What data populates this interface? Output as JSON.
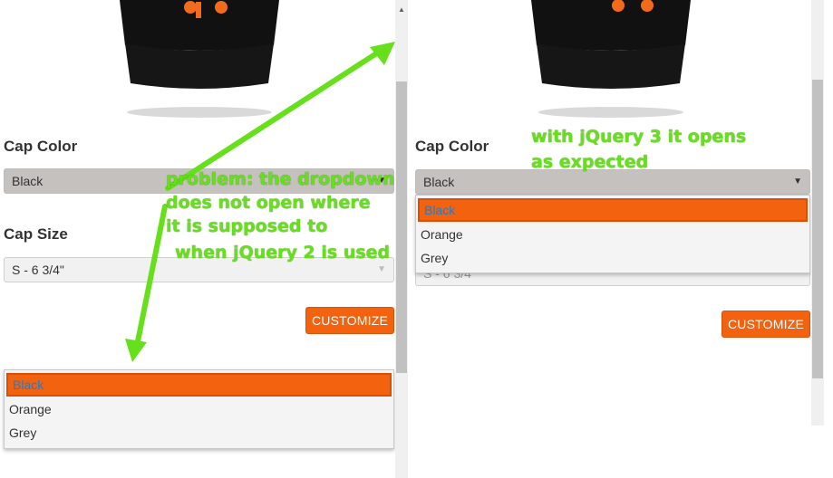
{
  "left": {
    "cap_color_label": "Cap Color",
    "color_select_value": "Black",
    "cap_size_label": "Cap Size",
    "size_select_value": "S - 6 3/4\"",
    "customize_label": "CUSTOMIZE",
    "dropdown_options": [
      "Black",
      "Orange",
      "Grey"
    ],
    "annotation_lines": [
      "problem: the dropdown",
      "does not open where",
      "it is supposed to",
      "when jQuery 2 is used"
    ]
  },
  "right": {
    "cap_color_label": "Cap Color",
    "color_select_value": "Black",
    "size_select_partial": "S - 6 3/4\"",
    "customize_label": "CUSTOMIZE",
    "dropdown_options": [
      "Black",
      "Orange",
      "Grey"
    ],
    "annotation_lines": [
      "with jQuery 3 it opens",
      "as expected"
    ]
  },
  "colors": {
    "accent_orange": "#f2620f",
    "annotation_green": "#66e01a",
    "cap_black": "#111111"
  },
  "icons": {
    "dropdown_caret": "caret-down-icon",
    "scroll_up": "scroll-up-arrow-icon",
    "arrow": "green-arrow-icon"
  }
}
